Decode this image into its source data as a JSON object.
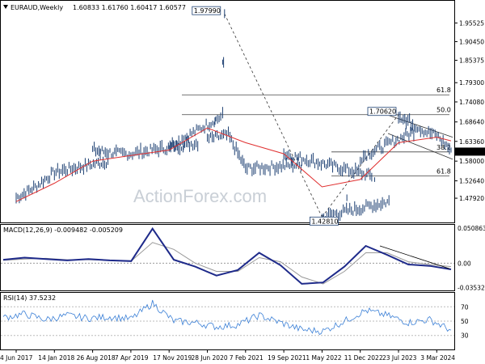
{
  "header": {
    "symbol_tf": "EURAUD,Weekly",
    "ohlc": "1.60833 1.61760 1.60417 1.60577"
  },
  "watermark": "ActionForex.com",
  "chart_data": [
    {
      "type": "line",
      "title": "EURAUD,Weekly",
      "x_tick_labels": [
        "4 Jun 2017",
        "14 Jan 2018",
        "26 Aug 2018",
        "7 Apr 2019",
        "17 Nov 2019",
        "28 Jun 2020",
        "7 Feb 2021",
        "19 Sep 2021",
        "1 May 2022",
        "11 Dec 2022",
        "23 Jul 2023",
        "3 Mar 2024"
      ],
      "y_tick_labels": [
        "1.95525",
        "1.90450",
        "1.85375",
        "1.79300",
        "1.74080",
        "1.68640",
        "1.63360",
        "1.58000",
        "1.52640",
        "1.47920"
      ],
      "ylim": [
        1.42,
        2.0
      ],
      "current_price": "1.60577",
      "price_points": [
        [
          "4 Jun 2017",
          1.48
        ],
        [
          "Sep 2017",
          1.51
        ],
        [
          "14 Jan 2018",
          1.55
        ],
        [
          "Apr 2018",
          1.58
        ],
        [
          "26 Aug 2018",
          1.61
        ],
        [
          "Dec 2018",
          1.6
        ],
        [
          "7 Apr 2019",
          1.6
        ],
        [
          "Aug 2019",
          1.63
        ],
        [
          "17 Nov 2019",
          1.62
        ],
        [
          "Feb 2020",
          1.7
        ],
        [
          "Mar 2020",
          1.9799
        ],
        [
          "Apr 2020",
          1.72
        ],
        [
          "28 Jun 2020",
          1.64
        ],
        [
          "Oct 2020",
          1.65
        ],
        [
          "7 Feb 2021",
          1.56
        ],
        [
          "May 2021",
          1.57
        ],
        [
          "19 Sep 2021",
          1.6
        ],
        [
          "Jan 2022",
          1.54
        ],
        [
          "1 May 2022",
          1.4281
        ],
        [
          "Aug 2022",
          1.47
        ],
        [
          "11 Dec 2022",
          1.59
        ],
        [
          "Apr 2023",
          1.66
        ],
        [
          "23 Jul 2023",
          1.7062
        ],
        [
          "Nov 2023",
          1.66
        ],
        [
          "3 Mar 2024",
          1.65
        ],
        [
          "Jun 2024",
          1.61
        ]
      ],
      "ma_points": [
        [
          "4 Jun 2017",
          1.47
        ],
        [
          "14 Jan 2018",
          1.52
        ],
        [
          "26 Aug 2018",
          1.58
        ],
        [
          "7 Apr 2019",
          1.595
        ],
        [
          "17 Nov 2019",
          1.61
        ],
        [
          "28 Jun 2020",
          1.67
        ],
        [
          "7 Feb 2021",
          1.63
        ],
        [
          "19 Sep 2021",
          1.6
        ],
        [
          "1 May 2022",
          1.51
        ],
        [
          "11 Dec 2022",
          1.53
        ],
        [
          "23 Jul 2023",
          1.63
        ],
        [
          "3 Mar 2024",
          1.645
        ],
        [
          "Jun 2024",
          1.635
        ]
      ],
      "annotations": [
        {
          "label": "1.97990",
          "value": 1.9799
        },
        {
          "label": "1.70620",
          "value": 1.7062
        },
        {
          "label": "1.42810",
          "value": 1.4281
        }
      ],
      "fib_levels": [
        {
          "label": "61.8",
          "value": 1.76
        },
        {
          "label": "50.0",
          "value": 1.7062
        },
        {
          "label": "38.2",
          "value": 1.605
        },
        {
          "label": "61.8",
          "value": 1.54
        }
      ]
    },
    {
      "type": "line",
      "title": "MACD(12,26,9) -0.009482 -0.005209",
      "y_tick_labels": [
        "0.050863",
        "0.00",
        "-0.035322"
      ],
      "series": [
        {
          "name": "MACD",
          "values": [
            0.005,
            0.008,
            0.006,
            0.004,
            0.006,
            0.004,
            0.003,
            0.05,
            0.005,
            -0.005,
            -0.018,
            -0.01,
            0.015,
            -0.003,
            -0.03,
            -0.028,
            -0.005,
            0.025,
            0.012,
            -0.002,
            -0.004,
            -0.009
          ]
        },
        {
          "name": "Signal",
          "values": [
            0.004,
            0.006,
            0.007,
            0.005,
            0.005,
            0.004,
            0.003,
            0.03,
            0.02,
            0.0,
            -0.012,
            -0.012,
            0.008,
            0.002,
            -0.02,
            -0.03,
            -0.012,
            0.015,
            0.015,
            0.002,
            -0.002,
            -0.005
          ]
        }
      ]
    },
    {
      "type": "line",
      "title": "RSI(14) 37.5232",
      "y_tick_labels": [
        "70",
        "50",
        "30"
      ],
      "series": [
        {
          "name": "RSI",
          "values": [
            55,
            60,
            52,
            58,
            54,
            56,
            53,
            75,
            50,
            48,
            42,
            45,
            58,
            48,
            38,
            36,
            50,
            65,
            58,
            48,
            52,
            37.5
          ]
        }
      ]
    }
  ]
}
